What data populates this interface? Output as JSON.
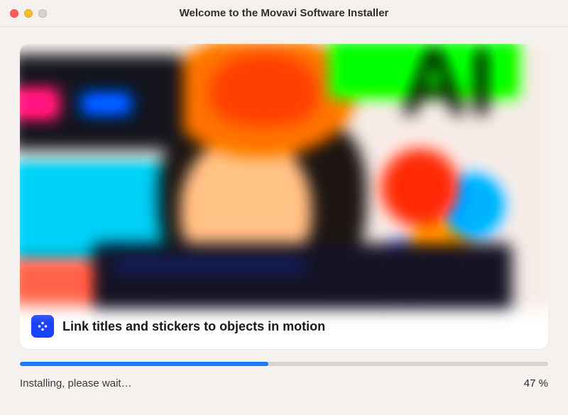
{
  "window": {
    "title": "Welcome to the Movavi Software Installer"
  },
  "feature": {
    "caption": "Link titles and stickers to objects in motion",
    "icon_name": "movavi-app-icon"
  },
  "progress": {
    "status_text": "Installing, please wait…",
    "percent_label": "47 %",
    "percent_value": 47
  },
  "colors": {
    "accent": "#1a7bff",
    "brand_icon_bg": "#1842ff"
  }
}
